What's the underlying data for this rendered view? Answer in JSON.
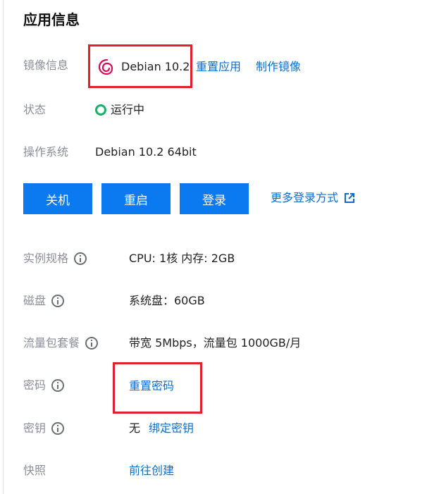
{
  "section_title": "应用信息",
  "image_info": {
    "label": "镜像信息",
    "os_logo": "debian-swirl-icon",
    "image_name": "Debian 10.2",
    "reset_app": "重置应用",
    "make_image": "制作镜像"
  },
  "status": {
    "label": "状态",
    "value": "运行中",
    "color": "#17b26a"
  },
  "os": {
    "label": "操作系统",
    "value": "Debian 10.2 64bit"
  },
  "actions": {
    "shutdown": "关机",
    "restart": "重启",
    "login": "登录",
    "more_login": "更多登录方式",
    "button_color": "#0b79f0"
  },
  "spec": {
    "label": "实例规格",
    "value": "CPU: 1核 内存: 2GB"
  },
  "disk": {
    "label": "磁盘",
    "value": "系统盘：60GB"
  },
  "traffic": {
    "label": "流量包套餐",
    "value": "带宽 5Mbps，流量包 1000GB/月"
  },
  "password": {
    "label": "密码",
    "value": "重置密码"
  },
  "key": {
    "label": "密钥",
    "value": "无",
    "bind": "绑定密钥"
  },
  "snapshot": {
    "label": "快照",
    "value": "前往创建"
  },
  "highlight_color": "#e0202e",
  "link_color": "#0a6ed1"
}
